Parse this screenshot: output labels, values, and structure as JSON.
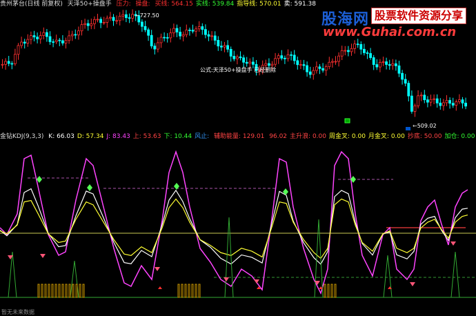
{
  "top": {
    "title": "贵州茅台(日线 前复权)",
    "indicator": "天泽50+操盘手",
    "values": [
      {
        "label": "压力",
        "value": "",
        "color": "#ff3030"
      },
      {
        "label": "操盘",
        "value": "",
        "color": "#ff3030"
      },
      {
        "label": "买线",
        "value": "564.15",
        "color": "#ff3030"
      },
      {
        "label": "实线",
        "value": "539.84",
        "color": "#33ff33"
      },
      {
        "label": "指导线",
        "value": "570.01",
        "color": "#ffff33"
      },
      {
        "label": "卖",
        "value": "591.38",
        "color": "#ffffff"
      }
    ],
    "high_label": "727.50",
    "low_label": "509.02",
    "formula_note": "公式:天泽50+操盘手 已经删除"
  },
  "bottom": {
    "title": "金钻KDJ(9,3,3)",
    "values": [
      {
        "label": "K",
        "value": "66.03",
        "color": "#ffffff"
      },
      {
        "label": "D",
        "value": "57.34",
        "color": "#ffff33"
      },
      {
        "label": "J",
        "value": "83.43",
        "color": "#ff44ff"
      },
      {
        "label": "上",
        "value": "53.63",
        "color": "#ff4444"
      },
      {
        "label": "下",
        "value": "10.44",
        "color": "#33ff33"
      },
      {
        "label": "风止",
        "value": "",
        "color": "#3399ff"
      },
      {
        "label": "辅助能量",
        "value": "129.01",
        "color": "#ff4444"
      },
      {
        "label": "",
        "value": "96.02",
        "color": "#ff4444"
      },
      {
        "label": "主升浪",
        "value": "0.00",
        "color": "#ff4444"
      },
      {
        "label": "周金叉",
        "value": "0.00",
        "color": "#ffff33"
      },
      {
        "label": "月金叉",
        "value": "0.00",
        "color": "#ffff33"
      },
      {
        "label": "抄底",
        "value": "50.00",
        "color": "#ff4444"
      },
      {
        "label": "加仓",
        "value": "0.00",
        "color": "#33ff33"
      }
    ],
    "caption": "暂无未来数据"
  },
  "watermark": {
    "site_cn": "股海网",
    "tagline": "股票软件资源分享",
    "url": "www.Guhai.com.cn"
  },
  "colors": {
    "up": "#ff3030",
    "down": "#00ffff",
    "k": "#ffffff",
    "d": "#ffff33",
    "j": "#ff44ff",
    "signal": "#33cc33"
  }
}
